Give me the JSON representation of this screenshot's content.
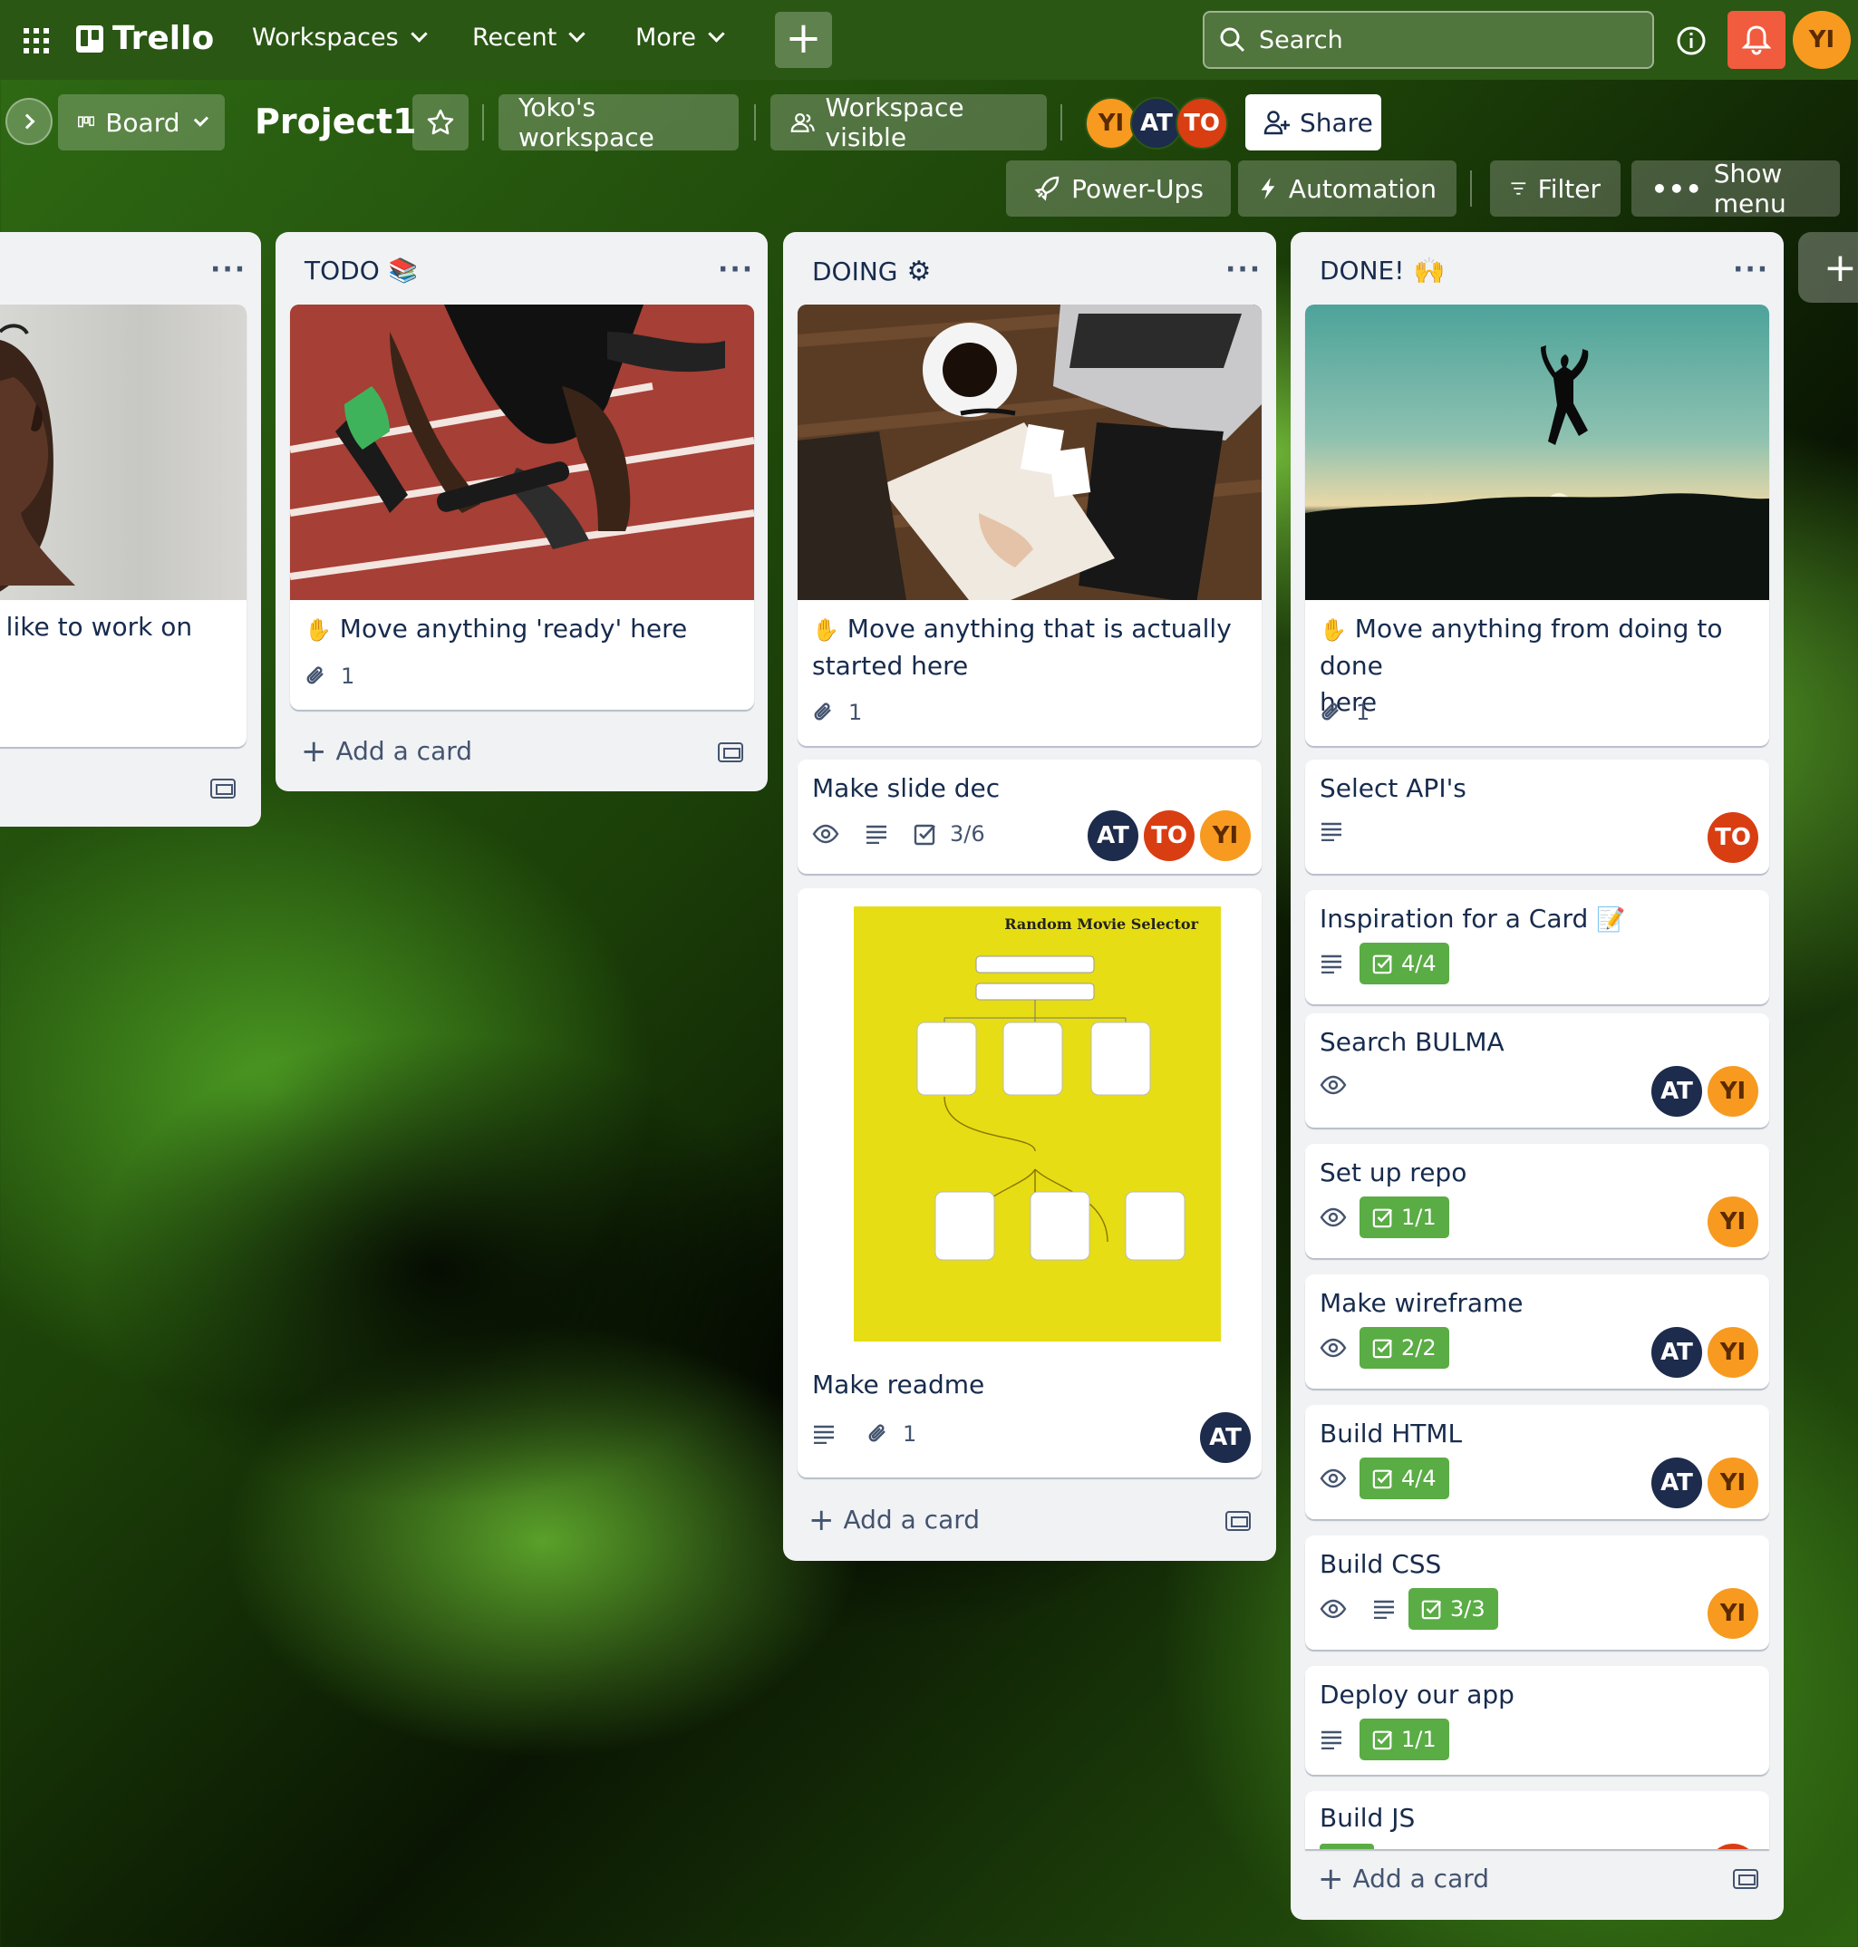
{
  "topbar": {
    "app_name": "Trello",
    "workspaces": "Workspaces",
    "recent": "Recent",
    "more": "More",
    "search_placeholder": "Search",
    "user_initials": "YI",
    "colors": {
      "bar": "#2a5713",
      "notification": "#f15b3e",
      "avatar": "#f79a1f"
    }
  },
  "board_header": {
    "view": "Board",
    "title": "Project1",
    "workspace": "Yoko's workspace",
    "visibility": "Workspace visible",
    "members": [
      "YI",
      "AT",
      "TO"
    ],
    "share": "Share",
    "power_ups": "Power-Ups",
    "automation": "Automation",
    "filter": "Filter",
    "show_menu": "Show menu"
  },
  "lists": [
    {
      "title": "",
      "cards": [
        {
          "title": "d like to work on"
        }
      ]
    },
    {
      "title": "TODO",
      "emoji": "📚",
      "cards": [
        {
          "title": "Move anything 'ready' here",
          "emoji": "✋",
          "attachments": "1"
        }
      ],
      "add_card": "Add a card"
    },
    {
      "title": "DOING",
      "emoji": "⚙",
      "cards": [
        {
          "title_line1": "Move anything that is actually",
          "title_line2": "started here",
          "emoji": "✋",
          "attachments": "1"
        },
        {
          "title": "Make slide dec",
          "checklist": "3/6",
          "members": [
            "AT",
            "TO",
            "YI"
          ]
        },
        {
          "title": "Make readme",
          "attachments": "1",
          "members": [
            "AT"
          ],
          "cover_title": "Random Movie Selector"
        }
      ],
      "add_card": "Add a card"
    },
    {
      "title": "DONE!",
      "emoji": "🙌",
      "cards": [
        {
          "title_line1": "Move anything from doing to done",
          "title_line2": "here",
          "emoji": "✋",
          "attachments": "1"
        },
        {
          "title": "Select API's",
          "members": [
            "TO"
          ]
        },
        {
          "title": "Inspiration for a Card",
          "emoji": "📝",
          "checklist": "4/4"
        },
        {
          "title": "Search BULMA",
          "members": [
            "AT",
            "YI"
          ]
        },
        {
          "title": "Set up repo",
          "checklist": "1/1",
          "members": [
            "YI"
          ]
        },
        {
          "title": "Make wireframe",
          "checklist": "2/2",
          "members": [
            "AT",
            "YI"
          ]
        },
        {
          "title": "Build HTML",
          "checklist": "4/4",
          "members": [
            "AT",
            "YI"
          ]
        },
        {
          "title": "Build CSS",
          "checklist": "3/3",
          "members": [
            "YI"
          ]
        },
        {
          "title": "Deploy our app",
          "checklist": "1/1"
        },
        {
          "title": "Build JS"
        }
      ],
      "add_card": "Add a card"
    }
  ],
  "add_list_icon": "plus-icon"
}
